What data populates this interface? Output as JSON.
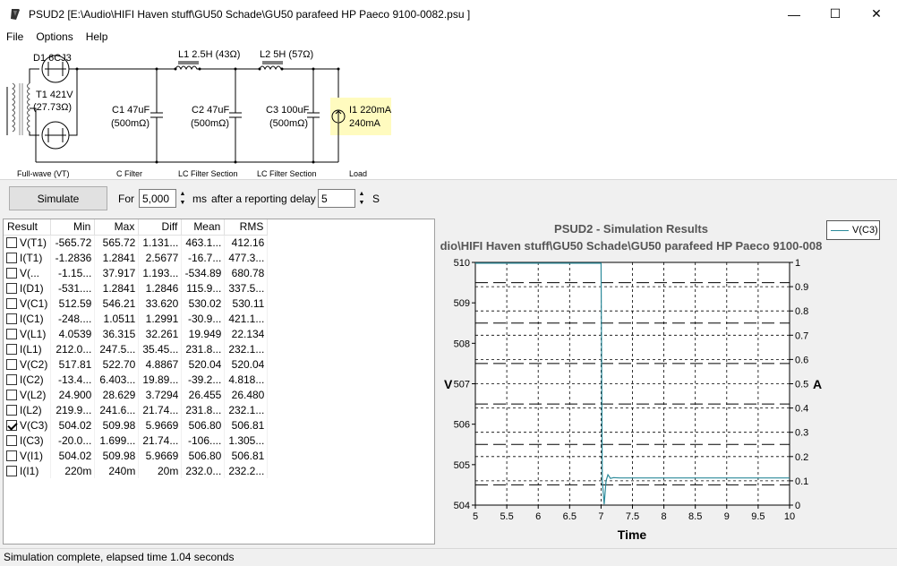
{
  "window": {
    "title": "PSUD2  [E:\\Audio\\HIFI Haven stuff\\GU50 Schade\\GU50 parafeed HP Paeco 9100-0082.psu ]",
    "minimize": "—",
    "maximize": "☐",
    "close": "✕"
  },
  "menu": [
    "File",
    "Options",
    "Help"
  ],
  "schematic": {
    "d1": "D1 6CJ3",
    "t1_line1": "T1 421V",
    "t1_line2": "(27.73Ω)",
    "l1": "L1 2.5H (43Ω)",
    "l2": "L2 5H (57Ω)",
    "c1_line1": "C1 47uF",
    "c1_line2": "(500mΩ)",
    "c2_line1": "C2 47uF",
    "c2_line2": "(500mΩ)",
    "c3_line1": "C3 100uF",
    "c3_line2": "(500mΩ)",
    "i1_line1": "I1 220mA",
    "i1_line2": "240mA",
    "sections": [
      "Full-wave (VT)",
      "C Filter",
      "LC Filter Section",
      "LC Filter Section",
      "Load"
    ]
  },
  "controls": {
    "simulate": "Simulate",
    "for_label": "For",
    "duration": "5,000",
    "ms_label": "ms",
    "delay_label": "after a reporting delay of",
    "delay": "5",
    "s_label": "S"
  },
  "table": {
    "headers": [
      "Result",
      "Min",
      "Max",
      "Diff",
      "Mean",
      "RMS"
    ],
    "rows": [
      {
        "checked": false,
        "name": "V(T1)",
        "min": "-565.72",
        "max": "565.72",
        "diff": "1.131...",
        "mean": "463.1...",
        "rms": "412.16"
      },
      {
        "checked": false,
        "name": "I(T1)",
        "min": "-1.2836",
        "max": "1.2841",
        "diff": "2.5677",
        "mean": "-16.7...",
        "rms": "477.3..."
      },
      {
        "checked": false,
        "name": "V(...",
        "min": "-1.15...",
        "max": "37.917",
        "diff": "1.193...",
        "mean": "-534.89",
        "rms": "680.78"
      },
      {
        "checked": false,
        "name": "I(D1)",
        "min": "-531....",
        "max": "1.2841",
        "diff": "1.2846",
        "mean": "115.9...",
        "rms": "337.5..."
      },
      {
        "checked": false,
        "name": "V(C1)",
        "min": "512.59",
        "max": "546.21",
        "diff": "33.620",
        "mean": "530.02",
        "rms": "530.11"
      },
      {
        "checked": false,
        "name": "I(C1)",
        "min": "-248....",
        "max": "1.0511",
        "diff": "1.2991",
        "mean": "-30.9...",
        "rms": "421.1..."
      },
      {
        "checked": false,
        "name": "V(L1)",
        "min": "4.0539",
        "max": "36.315",
        "diff": "32.261",
        "mean": "19.949",
        "rms": "22.134"
      },
      {
        "checked": false,
        "name": "I(L1)",
        "min": "212.0...",
        "max": "247.5...",
        "diff": "35.45...",
        "mean": "231.8...",
        "rms": "232.1..."
      },
      {
        "checked": false,
        "name": "V(C2)",
        "min": "517.81",
        "max": "522.70",
        "diff": "4.8867",
        "mean": "520.04",
        "rms": "520.04"
      },
      {
        "checked": false,
        "name": "I(C2)",
        "min": "-13.4...",
        "max": "6.403...",
        "diff": "19.89...",
        "mean": "-39.2...",
        "rms": "4.818..."
      },
      {
        "checked": false,
        "name": "V(L2)",
        "min": "24.900",
        "max": "28.629",
        "diff": "3.7294",
        "mean": "26.455",
        "rms": "26.480"
      },
      {
        "checked": false,
        "name": "I(L2)",
        "min": "219.9...",
        "max": "241.6...",
        "diff": "21.74...",
        "mean": "231.8...",
        "rms": "232.1..."
      },
      {
        "checked": true,
        "name": "V(C3)",
        "min": "504.02",
        "max": "509.98",
        "diff": "5.9669",
        "mean": "506.80",
        "rms": "506.81"
      },
      {
        "checked": false,
        "name": "I(C3)",
        "min": "-20.0...",
        "max": "1.699...",
        "diff": "21.74...",
        "mean": "-106....",
        "rms": "1.305..."
      },
      {
        "checked": false,
        "name": "V(I1)",
        "min": "504.02",
        "max": "509.98",
        "diff": "5.9669",
        "mean": "506.80",
        "rms": "506.81"
      },
      {
        "checked": false,
        "name": "I(I1)",
        "min": "220m",
        "max": "240m",
        "diff": "20m",
        "mean": "232.0...",
        "rms": "232.2..."
      }
    ]
  },
  "chart_data": {
    "type": "line",
    "title": "PSUD2 - Simulation Results",
    "subtitle": "dio\\HIFI Haven stuff\\GU50 Schade\\GU50 parafeed HP Paeco 9100-008",
    "xlabel": "Time",
    "ylabel": "V",
    "y2label": "A",
    "xlim": [
      5,
      10
    ],
    "ylim": [
      504,
      510
    ],
    "y2lim": [
      0,
      1
    ],
    "xticks": [
      "5",
      "5.5",
      "6",
      "6.5",
      "7",
      "7.5",
      "8",
      "8.5",
      "9",
      "9.5",
      "10"
    ],
    "yticks": [
      "504",
      "505",
      "506",
      "507",
      "508",
      "509",
      "510"
    ],
    "y2ticks": [
      "0",
      "0.1",
      "0.2",
      "0.3",
      "0.4",
      "0.5",
      "0.6",
      "0.7",
      "0.8",
      "0.9",
      "1"
    ],
    "grid": true,
    "legend": "top-right",
    "series": [
      {
        "name": "V(C3)",
        "color": "#2b8a9a",
        "x": [
          5,
          7.0,
          7.02,
          7.05,
          7.08,
          7.11,
          7.15,
          7.2,
          7.3,
          8,
          10
        ],
        "y": [
          509.98,
          509.98,
          504.6,
          504.02,
          504.6,
          504.75,
          504.66,
          504.68,
          504.67,
          504.67,
          504.67
        ]
      }
    ]
  },
  "status": "Simulation complete, elapsed time 1.04 seconds"
}
